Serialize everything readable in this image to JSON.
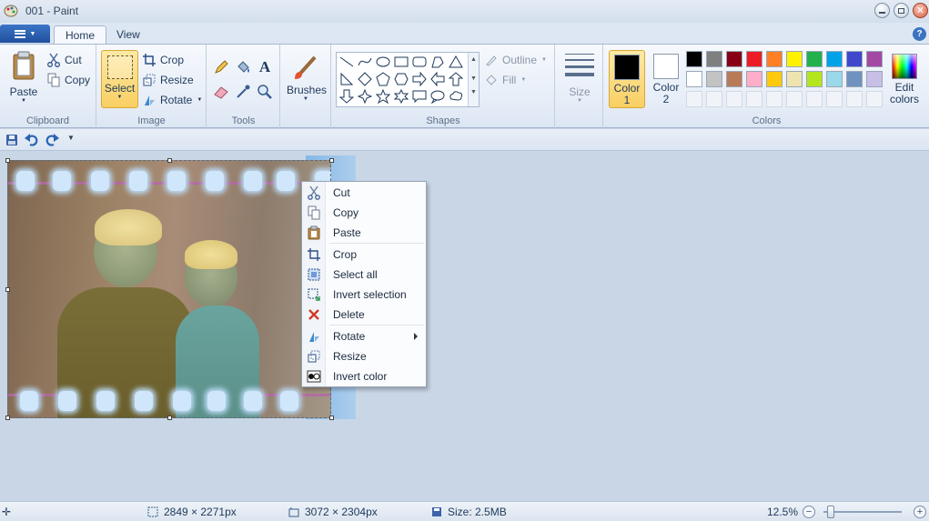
{
  "window": {
    "title": "001 - Paint"
  },
  "tabs": [
    {
      "label": "Home"
    },
    {
      "label": "View"
    }
  ],
  "help": "?",
  "clipboard": {
    "group": "Clipboard",
    "paste": "Paste",
    "cut": "Cut",
    "copy": "Copy"
  },
  "image": {
    "group": "Image",
    "select": "Select",
    "crop": "Crop",
    "resize": "Resize",
    "rotate": "Rotate"
  },
  "tools": {
    "group": "Tools"
  },
  "brushes": {
    "label": "Brushes"
  },
  "shapes": {
    "group": "Shapes",
    "outline": "Outline",
    "fill": "Fill"
  },
  "size": {
    "label": "Size"
  },
  "colors": {
    "group": "Colors",
    "color1": "Color 1",
    "color2": "Color 2",
    "edit": "Edit colors",
    "color1_value": "#000000",
    "color2_value": "#ffffff",
    "palette_row1": [
      "#000000",
      "#7f7f7f",
      "#880015",
      "#ed1c24",
      "#ff7f27",
      "#fff200",
      "#22b14c",
      "#00a2e8",
      "#3f48cc",
      "#a349a4"
    ],
    "palette_row2": [
      "#ffffff",
      "#c3c3c3",
      "#b97a57",
      "#ffaec9",
      "#ffc90e",
      "#efe4b0",
      "#b5e61d",
      "#99d9ea",
      "#7092be",
      "#c8bfe7"
    ]
  },
  "context_menu": [
    {
      "label": "Cut",
      "icon": "scissors-icon"
    },
    {
      "label": "Copy",
      "icon": "copy-icon"
    },
    {
      "label": "Paste",
      "icon": "paste-icon"
    },
    {
      "label": "Crop",
      "icon": "crop-icon"
    },
    {
      "label": "Select all",
      "icon": "select-all-icon"
    },
    {
      "label": "Invert selection",
      "icon": "invert-selection-icon"
    },
    {
      "label": "Delete",
      "icon": "delete-icon"
    },
    {
      "label": "Rotate",
      "icon": "rotate-icon"
    },
    {
      "label": "Resize",
      "icon": "resize-icon"
    },
    {
      "label": "Invert color",
      "icon": "invert-color-icon"
    }
  ],
  "status": {
    "selection_size": "2849 × 2271px",
    "image_size": "3072 × 2304px",
    "file_size": "Size: 2.5MB",
    "zoom": "12.5%"
  }
}
